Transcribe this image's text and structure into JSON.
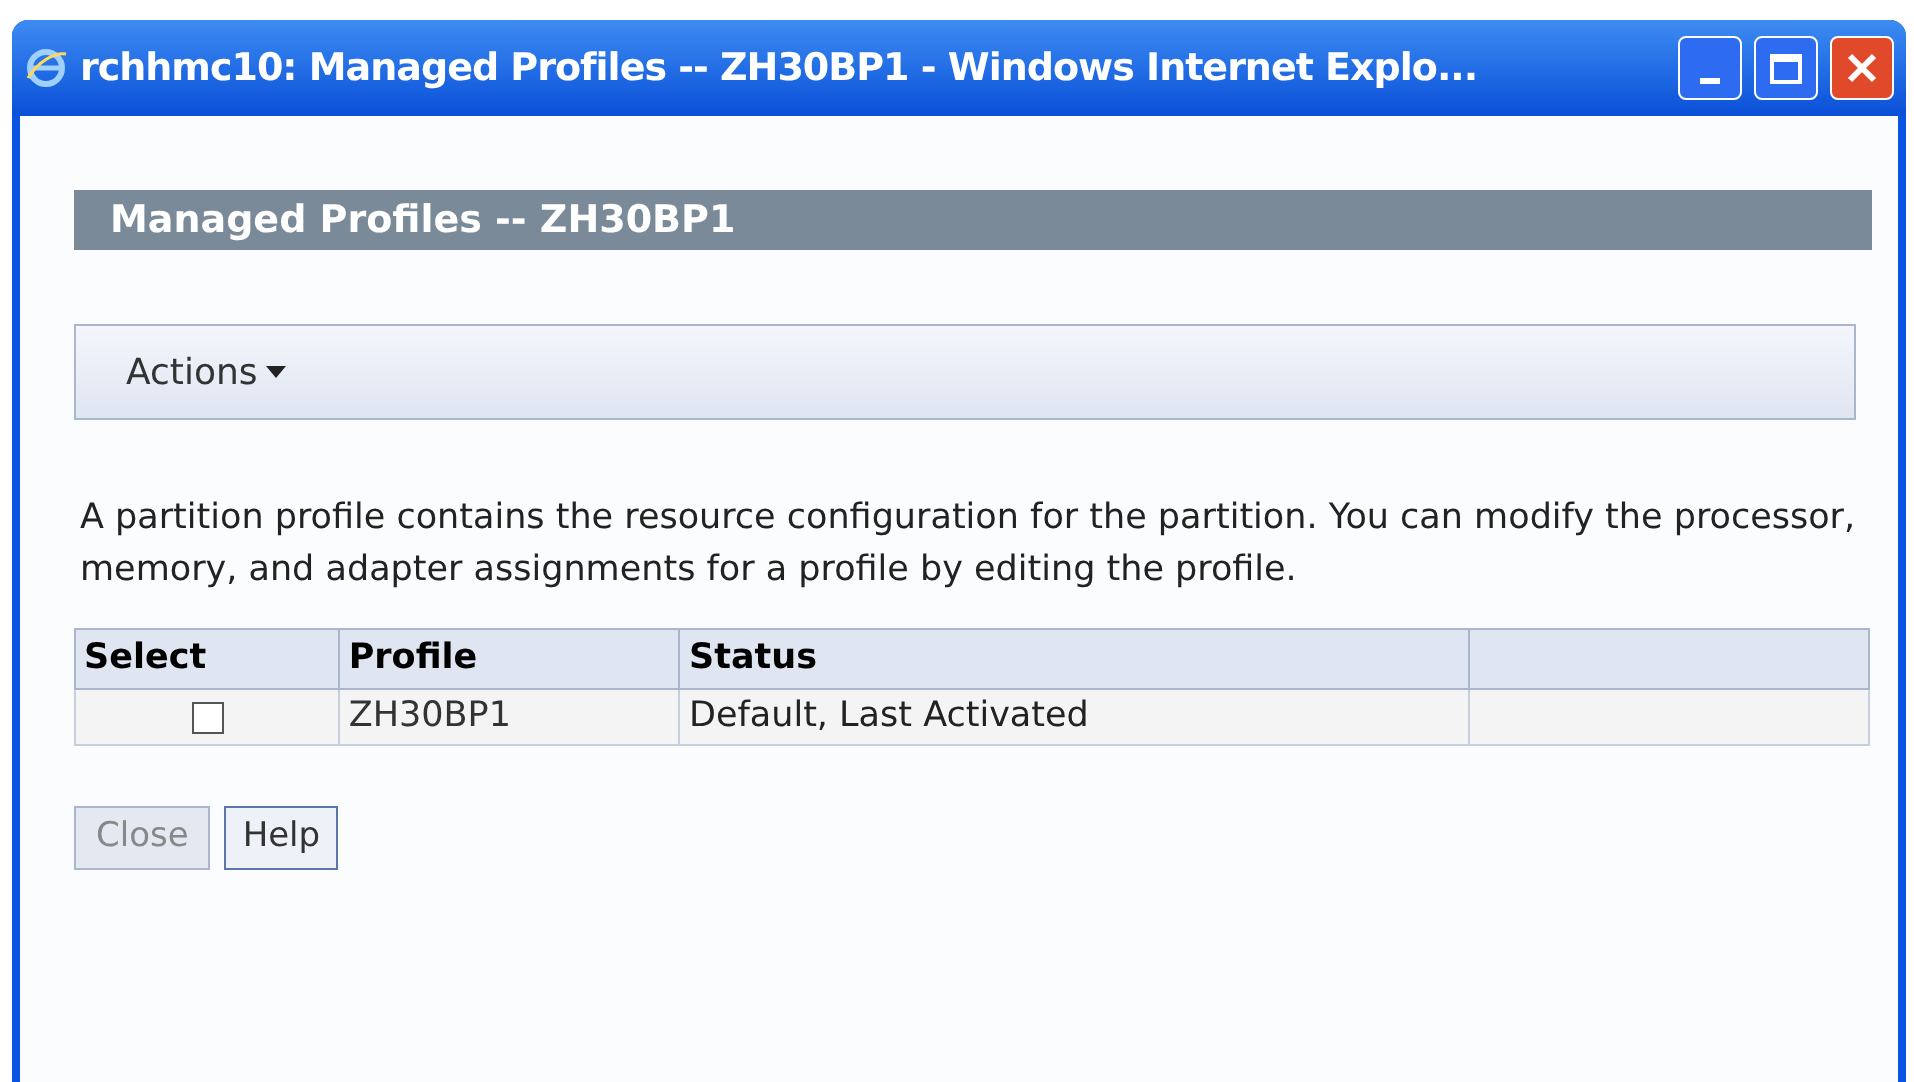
{
  "window": {
    "title": "rchhmc10: Managed Profiles -- ZH30BP1 - Windows Internet Explo..."
  },
  "header": {
    "title": "Managed Profiles -- ZH30BP1"
  },
  "actions_menu": {
    "label": "Actions"
  },
  "description": "A partition profile contains the resource configuration for the partition. You can modify the processor, memory, and adapter assignments for a profile by editing the profile.",
  "table": {
    "columns": [
      "Select",
      "Profile",
      "Status"
    ],
    "rows": [
      {
        "checked": false,
        "profile": "ZH30BP1",
        "status": "Default, Last Activated"
      }
    ]
  },
  "buttons": [
    {
      "label": "Close",
      "disabled": true
    },
    {
      "label": "Help",
      "disabled": false
    }
  ]
}
